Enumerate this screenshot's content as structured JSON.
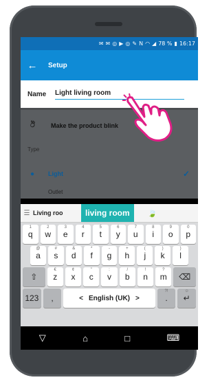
{
  "status_bar": {
    "battery": "78 %",
    "time": "16:17"
  },
  "app_bar": {
    "back_glyph": "←",
    "title": "Setup"
  },
  "name_field": {
    "label": "Name",
    "value": "Light living room"
  },
  "blink": {
    "label": "Make the product blink"
  },
  "type_section": {
    "label": "Type"
  },
  "type_options": [
    {
      "label": "Light",
      "selected": true
    },
    {
      "label": "Outlet",
      "selected": false
    }
  ],
  "keyboard": {
    "suggestions": {
      "first": "Living roo",
      "highlighted": "living room",
      "emoji": "🍃"
    },
    "row1": [
      {
        "k": "q",
        "s": "1"
      },
      {
        "k": "w",
        "s": "2"
      },
      {
        "k": "e",
        "s": "3"
      },
      {
        "k": "r",
        "s": "4"
      },
      {
        "k": "t",
        "s": "5"
      },
      {
        "k": "y",
        "s": "6"
      },
      {
        "k": "u",
        "s": "7"
      },
      {
        "k": "i",
        "s": "8"
      },
      {
        "k": "o",
        "s": "9"
      },
      {
        "k": "p",
        "s": "0"
      }
    ],
    "row2": [
      {
        "k": "a",
        "s": "@"
      },
      {
        "k": "s",
        "s": "#"
      },
      {
        "k": "d",
        "s": "&"
      },
      {
        "k": "f",
        "s": "*"
      },
      {
        "k": "g",
        "s": "-"
      },
      {
        "k": "h",
        "s": "+"
      },
      {
        "k": "j",
        "s": "("
      },
      {
        "k": "k",
        "s": ")"
      },
      {
        "k": "l",
        "s": ")"
      }
    ],
    "row3": [
      {
        "k": "z",
        "s": "€"
      },
      {
        "k": "x",
        "s": "¢"
      },
      {
        "k": "c",
        "s": "\""
      },
      {
        "k": "v",
        "s": ":"
      },
      {
        "k": "b",
        "s": "/"
      },
      {
        "k": "n",
        "s": "!"
      },
      {
        "k": "m",
        "s": "?"
      }
    ],
    "shift": "⇧",
    "backspace": "⌫",
    "numbers": "123",
    "comma": ",",
    "space_left": "<",
    "language": "English (UK)",
    "space_right": ">",
    "period": ".",
    "period_sup": "?!",
    "enter": "↵",
    "enter_sup": "☺"
  },
  "nav_bar": {
    "back": "▽",
    "home": "⌂",
    "recents": "□",
    "keyboard": "⌨"
  }
}
